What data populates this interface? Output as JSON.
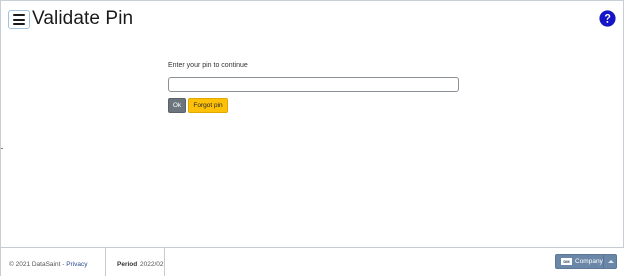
{
  "header": {
    "title": "Validate Pin",
    "menu_icon": "hamburger-icon",
    "help_icon": "question-circle-icon"
  },
  "form": {
    "label": "Enter your pin to continue",
    "pin_value": "",
    "ok_label": "Ok",
    "forgot_label": "Forgot pin"
  },
  "footer": {
    "copyright": "© 2021 DataSaint",
    "separator": " - ",
    "privacy_label": "Privacy",
    "period_label": "Period",
    "period_value": "2022/02",
    "company_logo": "DM",
    "company_label": "Company"
  },
  "colors": {
    "ok_button": "#6c757d",
    "forgot_button": "#ffc107",
    "company_button": "#6b87a8",
    "help_icon": "#1515c8"
  }
}
